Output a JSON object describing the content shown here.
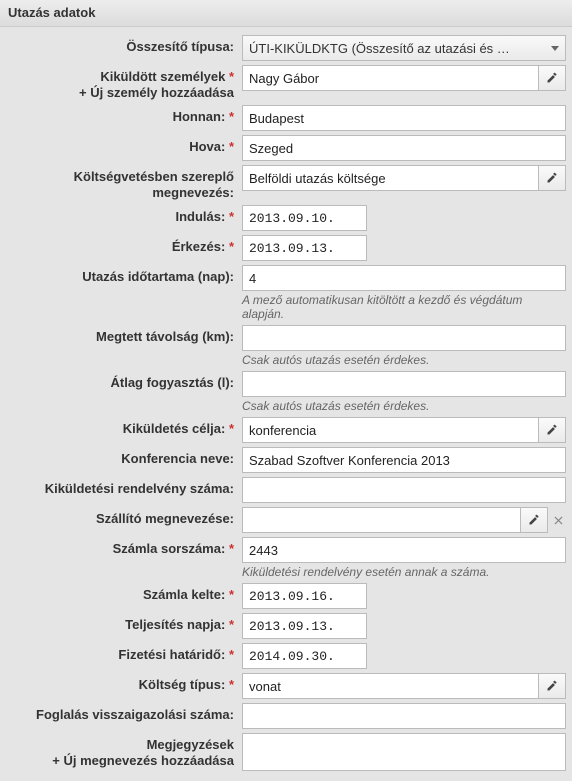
{
  "panelTitle": "Utazás adatok",
  "labels": {
    "osszesito": "Összesítő típusa:",
    "kikuldott": "Kiküldött személyek",
    "kikuldott_add": "+ Új személy hozzáadása",
    "honnan": "Honnan:",
    "hova": "Hova:",
    "koltsegvetes": "Költségvetésben szereplő megnevezés:",
    "indulas": "Indulás:",
    "erkezes": "Érkezés:",
    "idotartam": "Utazás időtartama (nap):",
    "tavolsag": "Megtett távolság (km):",
    "fogyasztas": "Átlag fogyasztás (l):",
    "celja": "Kiküldetés célja:",
    "konferencia": "Konferencia neve:",
    "rendelveny": "Kiküldetési rendelvény száma:",
    "szallito": "Szállító megnevezése:",
    "szamla_sorszam": "Számla sorszáma:",
    "szamla_kelte": "Számla kelte:",
    "teljesites": "Teljesítés napja:",
    "fizetesi": "Fizetési határidő:",
    "koltseg_tipus": "Költség típus:",
    "foglalas": "Foglalás visszaigazolási száma:",
    "megjegyzes": "Megjegyzések",
    "megjegyzes_add": "+ Új megnevezés hozzáadása",
    "req": "*"
  },
  "hints": {
    "idotartam": "A mező automatikusan kitöltött a kezdő és végdátum alapján.",
    "tavolsag": "Csak autós utazás esetén érdekes.",
    "fogyasztas": "Csak autós utazás esetén érdekes.",
    "szamla_sorszam": "Kiküldetési rendelvény esetén annak a száma."
  },
  "values": {
    "osszesito": "ÚTI-KIKÜLDKTG (Összesítő az utazási és …",
    "kikuldott": "Nagy Gábor",
    "honnan": "Budapest",
    "hova": "Szeged",
    "koltsegvetes": "Belföldi utazás költsége",
    "indulas": "2013.09.10.",
    "erkezes": "2013.09.13.",
    "idotartam": "4",
    "tavolsag": "",
    "fogyasztas": "",
    "celja": "konferencia",
    "konferencia": "Szabad Szoftver Konferencia 2013",
    "rendelveny": "",
    "szallito": "",
    "szamla_sorszam": "2443",
    "szamla_kelte": "2013.09.16.",
    "teljesites": "2013.09.13.",
    "fizetesi": "2014.09.30.",
    "koltseg_tipus": "vonat",
    "foglalas": "",
    "megjegyzes": ""
  }
}
